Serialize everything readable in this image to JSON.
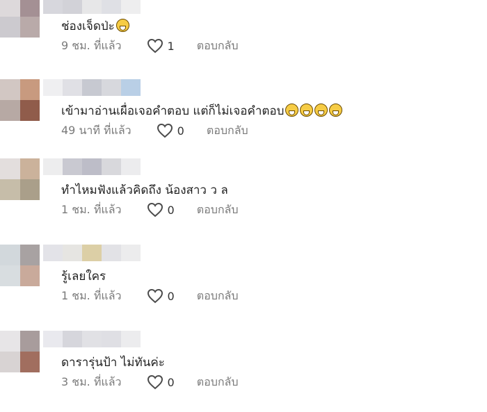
{
  "comments": [
    {
      "text": "ช่องเจ็ดป่ะ",
      "emoji_count": 1,
      "time": "9 ชม. ที่แล้ว",
      "likes": "1",
      "reply": "ตอบกลับ",
      "avatar_colors": [
        "#ddd9db",
        "#a49094",
        "#cccacf",
        "#b9aaa9"
      ],
      "name_colors": [
        "#d7d7dd",
        "#d2d2d8",
        "#e7e7e8",
        "#dfe0e5",
        "#eeeeef"
      ]
    },
    {
      "text": "เข้ามาอ่านเผื่อเจอคำตอบ แต่ก็ไม่เจอคำตอบ",
      "emoji_count": 4,
      "time": "49 นาที ที่แล้ว",
      "likes": "0",
      "reply": "ตอบกลับ",
      "avatar_colors": [
        "#d2c7c3",
        "#c89a7f",
        "#b7a9a4",
        "#905c4b"
      ],
      "name_colors": [
        "#efeff1",
        "#e0e0e5",
        "#c7c9d1",
        "#d7d8dd",
        "#b9cfe6"
      ]
    },
    {
      "text": "ทำไหมฟังแล้วคิดถึง น้องสาว ว ล",
      "emoji_count": 0,
      "time": "1 ชม. ที่แล้ว",
      "likes": "0",
      "reply": "ตอบกลับ",
      "avatar_colors": [
        "#e3dedd",
        "#cbb29b",
        "#c6bda9",
        "#aa9f8a"
      ],
      "name_colors": [
        "#ededee",
        "#c9c9d1",
        "#bdbdc8",
        "#d8d8dc",
        "#ececee"
      ]
    },
    {
      "text": "รู้เลยใคร",
      "emoji_count": 0,
      "time": "1 ชม. ที่แล้ว",
      "likes": "0",
      "reply": "ตอบกลับ",
      "avatar_colors": [
        "#d2d8dc",
        "#a8a2a2",
        "#d8dde0",
        "#c9aa9b"
      ],
      "name_colors": [
        "#e3e3e8",
        "#e6e5e2",
        "#dccfa6",
        "#e2e2e6",
        "#ececed"
      ]
    },
    {
      "text": "ดารารุ่นป้า ไม่ทันค่ะ",
      "emoji_count": 0,
      "time": "3 ชม. ที่แล้ว",
      "likes": "0",
      "reply": "ตอบกลับ",
      "avatar_colors": [
        "#e7e5e7",
        "#a89c9c",
        "#d8d3d3",
        "#a16e5f"
      ],
      "name_colors": [
        "#e9e9ee",
        "#d6d6dc",
        "#e1e1e5",
        "#dfdfe4",
        "#ececee"
      ]
    }
  ]
}
